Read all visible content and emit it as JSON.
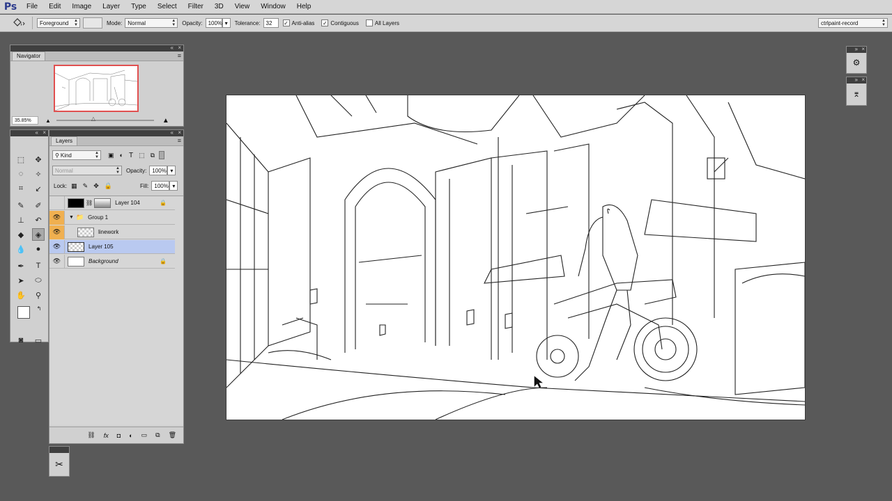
{
  "app": {
    "logo": "Ps"
  },
  "menu": [
    "File",
    "Edit",
    "Image",
    "Layer",
    "Type",
    "Select",
    "Filter",
    "3D",
    "View",
    "Window",
    "Help"
  ],
  "options": {
    "fill_source": "Foreground",
    "mode_label": "Mode:",
    "mode_value": "Normal",
    "opacity_label": "Opacity:",
    "opacity_value": "100%",
    "tolerance_label": "Tolerance:",
    "tolerance_value": "32",
    "antialias_label": "Anti-alias",
    "contiguous_label": "Contiguous",
    "all_layers_label": "All Layers",
    "workspace": "ctrlpaint-record"
  },
  "navigator": {
    "title": "Navigator",
    "zoom": "35.85%"
  },
  "layers": {
    "title": "Layers",
    "filter_kind": "Kind",
    "blend_mode": "Normal",
    "opacity_label": "Opacity:",
    "opacity_value": "100%",
    "lock_label": "Lock:",
    "fill_label": "Fill:",
    "fill_value": "100%",
    "items": [
      {
        "name": "Layer 104"
      },
      {
        "name": "Group 1"
      },
      {
        "name": "linework"
      },
      {
        "name": "Layer 105"
      },
      {
        "name": "Background"
      }
    ]
  },
  "icons": {
    "eye": "eye-icon",
    "lock": "lock-icon",
    "paint_bucket": "paint-bucket-icon"
  }
}
